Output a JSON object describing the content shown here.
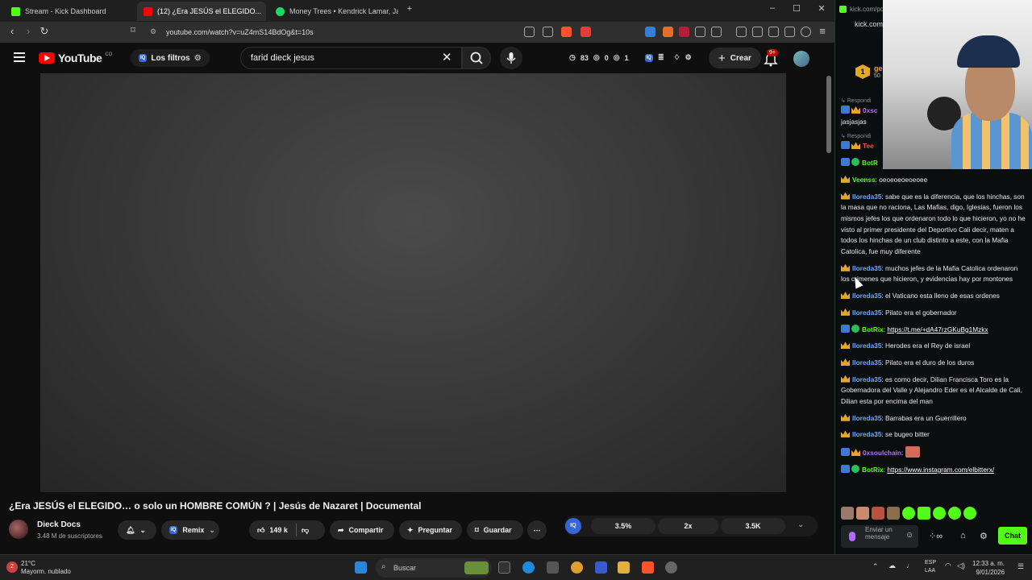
{
  "browser": {
    "tabs": [
      {
        "label": "Stream - Kick Dashboard",
        "active": false,
        "color": "#53fc18"
      },
      {
        "label": "(12) ¿Era JESÚS el ELEGIDO...",
        "active": true,
        "color": "#ff0000"
      },
      {
        "label": "Money Trees • Kendrick Lamar, Ja",
        "active": false,
        "color": "#1ed760"
      }
    ],
    "url": "youtube.com/watch?v=uZ4mS14BdOg&t=10s"
  },
  "youtube": {
    "logo_text": "YouTube",
    "logo_sup": "CO",
    "filters_label": "Los filtros",
    "search_value": "farid dieck jesus",
    "stats": {
      "views": "83",
      "eye": "0",
      "other": "1"
    },
    "create_label": "Crear",
    "notif_badge": "9+",
    "video_title": "¿Era JESÚS el ELEGIDO… o solo un HOMBRE COMÚN ? | Jesús de Nazaret | Documental",
    "channel_name": "Dieck Docs",
    "channel_subs": "3.48 M de suscriptores",
    "remix_label": "Remix",
    "likes": "149 k",
    "share_label": "Compartir",
    "ask_label": "Preguntar",
    "save_label": "Guardar",
    "tool_values": [
      "3.5%",
      "2x",
      "3.5K"
    ]
  },
  "kick": {
    "tab_label": "kick.com/pc",
    "url": "kick.com",
    "coin_label": "1",
    "header_text": "ge",
    "header_sub": "50",
    "reply_label": "Respondi",
    "messages": [
      {
        "user": "0xsc",
        "text": "",
        "color": "#b36bff",
        "badges": "bc",
        "reply": true
      },
      {
        "user": "",
        "text": "jasjasjas",
        "color": "#eaeaea",
        "badges": "",
        "reply": false
      },
      {
        "user": "Tee",
        "text": "",
        "color": "#ff4d4d",
        "badges": "bc",
        "reply": true
      },
      {
        "user": "BotR",
        "text": "",
        "color": "#53fc18",
        "badges": "bg",
        "reply": false
      },
      {
        "user": "Veenss",
        "text": ": oeoeoeoeoeoee",
        "color": "#53fc18",
        "badges": "c",
        "reply": false
      },
      {
        "user": "lloreda35",
        "text": ": sabe que es la diferencia, que los hinchas, son la masa que no raciona, Las Mafias, digo, Iglesias, fueron los mismos jefes los que ordenaron todo lo que hicieron, yo no he visto al primer presidente del Deportivo Cali decir, maten a todos los hinchas de un club distinto a este, con la Mafia Catolica, fue muy diferente",
        "color": "#6da8ff",
        "badges": "c",
        "reply": false
      },
      {
        "user": "lloreda35",
        "text": ": muchos jefes de la Mafia Catolica ordenaron los crimenes que hicieron, y evidencias hay por montones",
        "color": "#6da8ff",
        "badges": "c",
        "reply": false
      },
      {
        "user": "lloreda35",
        "text": ": el Vaticano esta lleno de esas ordenes",
        "color": "#6da8ff",
        "badges": "c",
        "reply": false
      },
      {
        "user": "lloreda35",
        "text": ": Pilato era el gobernador",
        "color": "#6da8ff",
        "badges": "c",
        "reply": false
      },
      {
        "user": "BotRix",
        "text": ": ",
        "link": "https://t.me/+dA47rzGKuBg1Mzkx",
        "color": "#53fc18",
        "badges": "bg",
        "reply": false
      },
      {
        "user": "lloreda35",
        "text": ": Herodes era el Rey de israel",
        "color": "#6da8ff",
        "badges": "c",
        "reply": false
      },
      {
        "user": "lloreda35",
        "text": ": Pilato era el duro de los duros",
        "color": "#6da8ff",
        "badges": "c",
        "reply": false
      },
      {
        "user": "lloreda35",
        "text": ": es como decir, Dilian Francisca Toro es la Gobernadora del Valle y Alejandro Eder es el Alcalde de Cali, Dilian esta por encima del man",
        "color": "#6da8ff",
        "badges": "c",
        "reply": false
      },
      {
        "user": "lloreda35",
        "text": ": Barrabas era un Guerrillero",
        "color": "#6da8ff",
        "badges": "c",
        "reply": false
      },
      {
        "user": "lloreda35",
        "text": ": se bugeo bitter",
        "color": "#6da8ff",
        "badges": "c",
        "reply": false
      },
      {
        "user": "0xsoulchain",
        "text": ":",
        "color": "#b36bff",
        "badges": "bc",
        "reply": false
      },
      {
        "user": "BotRix",
        "text": ": ",
        "link": "https://www.instagram.com/elbitterx/",
        "color": "#53fc18",
        "badges": "bg",
        "reply": false
      }
    ],
    "input_placeholder": "Enviar un mensaje",
    "chat_button": "Chat"
  },
  "taskbar": {
    "temp": "21°C",
    "weather": "Mayorm. nublado",
    "search_label": "Buscar",
    "lang": "ESP",
    "lang2": "LAA",
    "time": "12:33 a. m.",
    "date": "9/01/2026"
  }
}
